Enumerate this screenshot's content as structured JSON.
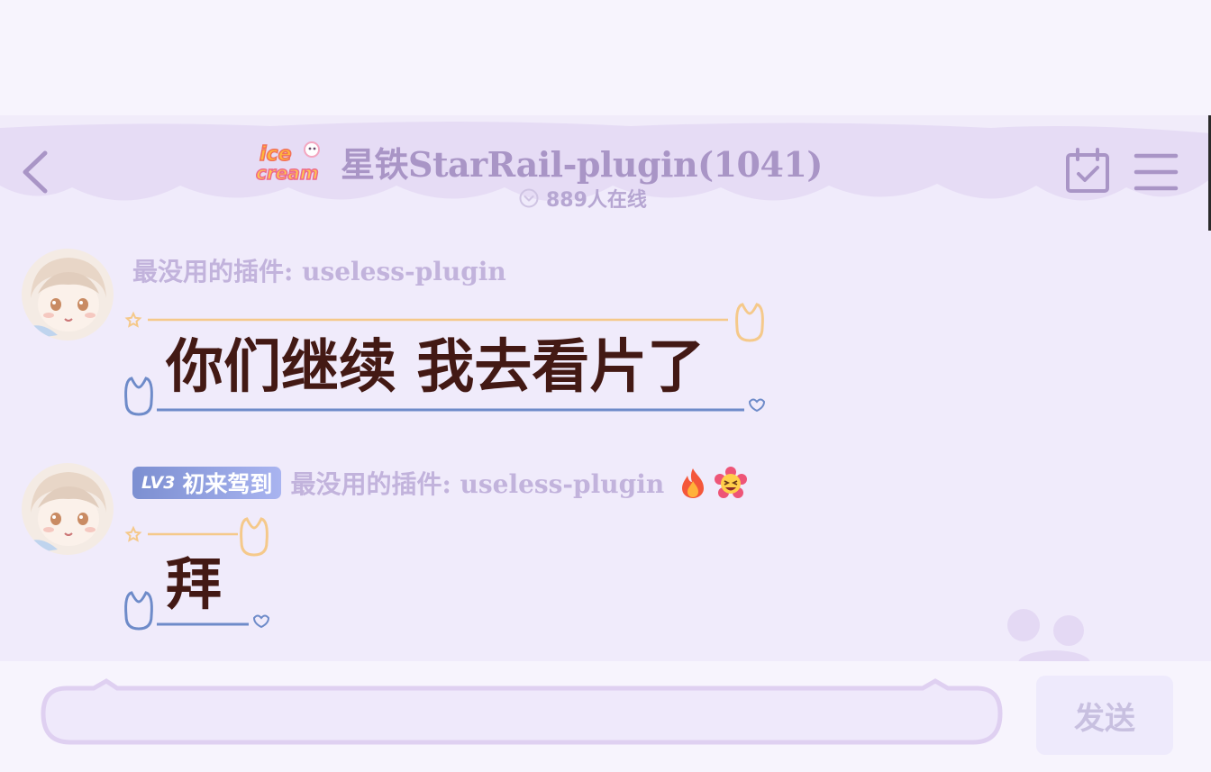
{
  "header": {
    "group_title": "星铁StarRail-plugin(1041)",
    "online_count": "889人在线",
    "logo_text_top": "ice",
    "logo_text_bottom": "cream",
    "icons": [
      "back-arrow-icon",
      "calendar-check-icon",
      "menu-icon",
      "chevron-down-circle-icon"
    ]
  },
  "messages": [
    {
      "sender": "最没用的插件: useless-plugin",
      "text": "你们继续 我去看片了"
    },
    {
      "badge_level": "LV3",
      "badge_title": "初来驾到",
      "sender": "最没用的插件: useless-plugin",
      "emojis": [
        "fire-icon",
        "laughing-flower-icon"
      ],
      "text": "拜"
    }
  ],
  "input": {
    "value": "",
    "send_label": "发送"
  },
  "colors": {
    "background": "#f0ebfb",
    "title": "#a995c6",
    "sender": "#c2b3dc",
    "message_text": "#431914",
    "bubble_top_line": "#f5c98a",
    "bubble_bottom_line": "#6e8bc9"
  }
}
